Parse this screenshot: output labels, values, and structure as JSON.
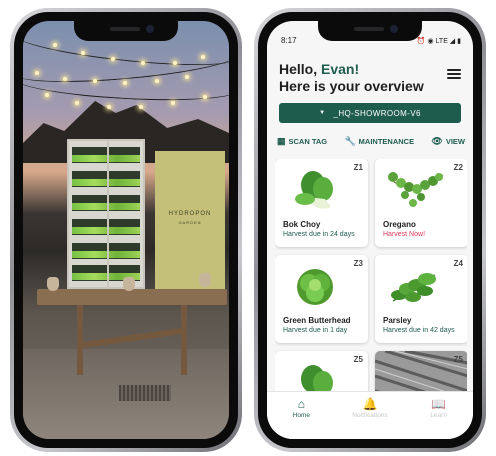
{
  "app": {
    "status_time": "8:17",
    "status_icons": "⏰ ◉ LTE ◢ ▮",
    "greeting_prefix": "Hello,",
    "user_name": "Evan!",
    "overview_text": "Here is your overview",
    "selector_label": "_HQ-SHOWROOM-V6",
    "actions": {
      "scan_tag": "SCAN TAG",
      "maintenance": "MAINTENANCE",
      "view": "VIEW"
    },
    "zones": [
      {
        "zone": "Z1",
        "plant": "Bok Choy",
        "harvest": "Harvest due in 24 days",
        "now": false
      },
      {
        "zone": "Z2",
        "plant": "Oregano",
        "harvest": "Harvest Now!",
        "now": true
      },
      {
        "zone": "Z3",
        "plant": "Green Butterhead",
        "harvest": "Harvest due in 1 day",
        "now": false
      },
      {
        "zone": "Z4",
        "plant": "Parsley",
        "harvest": "Harvest due in 42 days",
        "now": false
      },
      {
        "zone": "Z5",
        "plant": "",
        "harvest": "",
        "now": false
      },
      {
        "zone": "Z5",
        "plant": "",
        "harvest": "",
        "now": false
      }
    ],
    "nav": {
      "home": "Home",
      "notifications": "Notifications",
      "learn": "Learn"
    }
  },
  "photo": {
    "sign_text": "HYDROPON",
    "sign_sub": "GARDEN"
  },
  "colors": {
    "brand_green": "#1e5c4e",
    "harvest_now": "#e23a5b"
  }
}
